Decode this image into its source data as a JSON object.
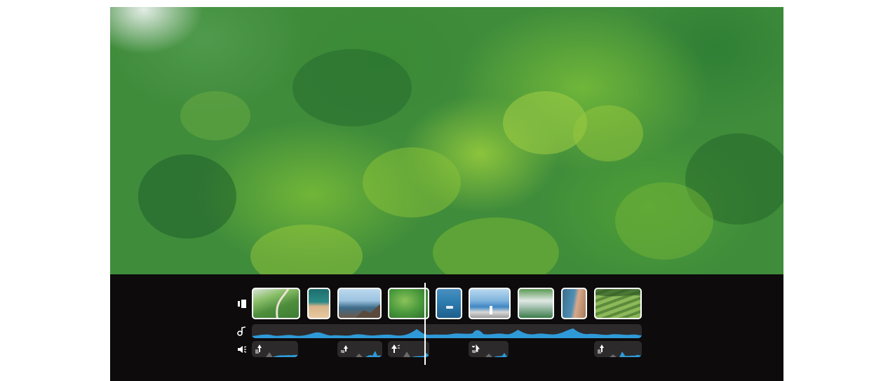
{
  "video": {
    "description_icon": "forest-aerial-preview",
    "colors": {
      "foliage": "#3f8c3b",
      "timeline_bg": "#0d0b0b",
      "track_bg": "#2c2a2b",
      "waveform": "#2f9ad8"
    }
  },
  "timeline": {
    "tracks": [
      {
        "icon": "video-track-icon"
      },
      {
        "icon": "music-note-icon"
      },
      {
        "icon": "sound-effects-icon"
      }
    ],
    "clips": [
      {
        "name": "clip-green-fields-road",
        "colors": [
          "#6da94b",
          "#3b7d35",
          "#d8e4d6"
        ]
      },
      {
        "name": "clip-beach-aerial",
        "colors": [
          "#1f6e6e",
          "#d8b48a",
          "#e6c9a0"
        ]
      },
      {
        "name": "clip-sea-rocks",
        "colors": [
          "#9cc3e0",
          "#3d6b8a",
          "#6b5a4a"
        ]
      },
      {
        "name": "clip-forest-hills",
        "colors": [
          "#4a9a3c",
          "#2e6b2c",
          "#8bc25a"
        ]
      },
      {
        "name": "clip-boat-sea",
        "colors": [
          "#1d5f8c",
          "#2f7fb3",
          "#cfe3ef"
        ]
      },
      {
        "name": "clip-lighthouse-coast",
        "colors": [
          "#3f87c4",
          "#b9d8ef",
          "#d8d8d8"
        ]
      },
      {
        "name": "clip-misty-mountains",
        "colors": [
          "#3d7c4a",
          "#dfe8e4",
          "#5c9a56"
        ]
      },
      {
        "name": "clip-coastline-beach",
        "colors": [
          "#4f8fb5",
          "#d9a88a",
          "#3c6f8a"
        ]
      },
      {
        "name": "clip-rice-terraces",
        "colors": [
          "#5b8a3a",
          "#8cb85a",
          "#2f5a25"
        ]
      }
    ]
  }
}
